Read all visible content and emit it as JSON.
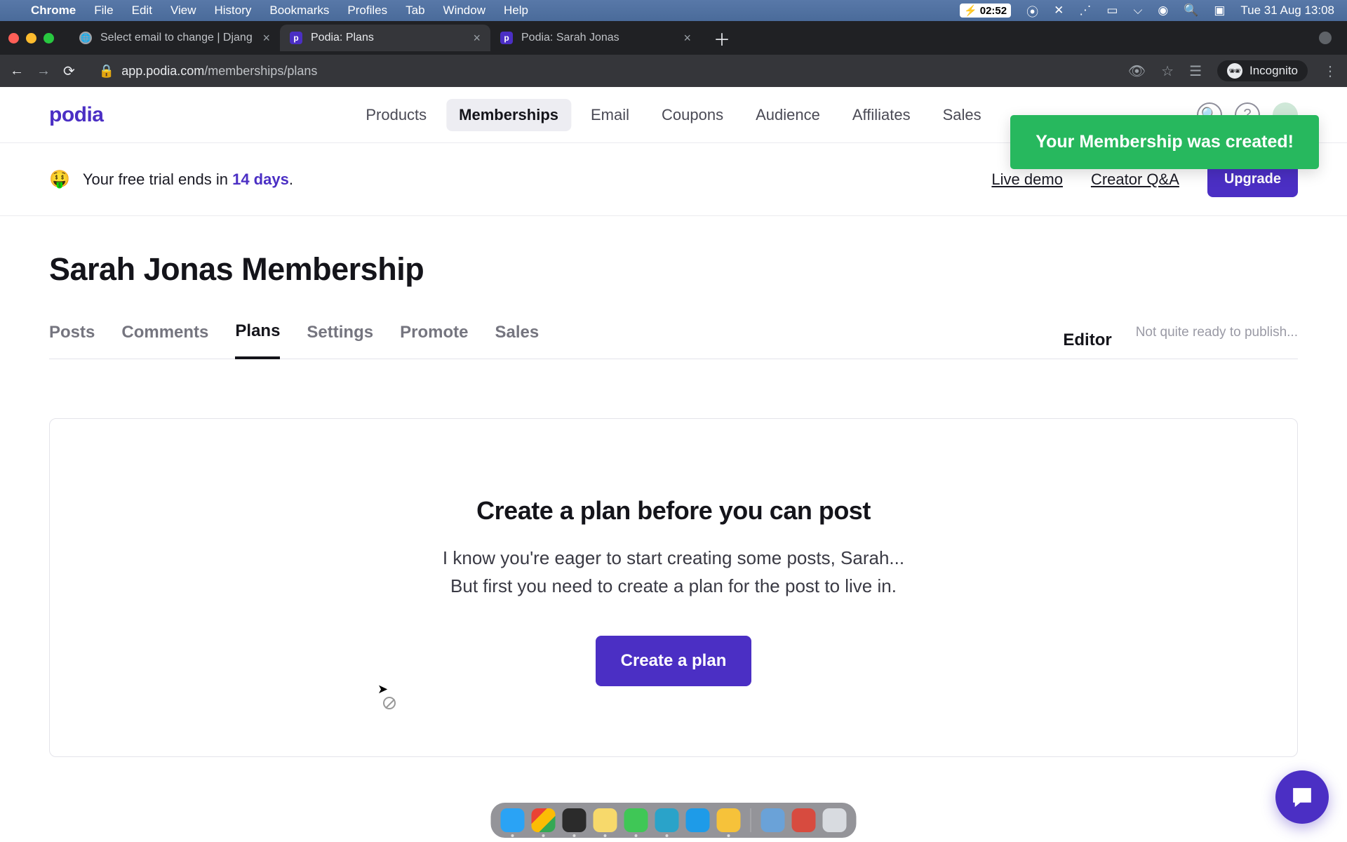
{
  "menubar": {
    "app": "Chrome",
    "items": [
      "File",
      "Edit",
      "View",
      "History",
      "Bookmarks",
      "Profiles",
      "Tab",
      "Window",
      "Help"
    ],
    "battery": "02:52",
    "datetime": "Tue 31 Aug  13:08"
  },
  "tabs": [
    {
      "title": "Select email to change | Djang",
      "favicon": "globe",
      "active": false
    },
    {
      "title": "Podia: Plans",
      "favicon": "p",
      "active": true
    },
    {
      "title": "Podia: Sarah Jonas",
      "favicon": "p",
      "active": false
    }
  ],
  "url": {
    "host": "app.podia.com",
    "path": "/memberships/plans",
    "incognito_label": "Incognito"
  },
  "header": {
    "logo": "podia",
    "nav": [
      "Products",
      "Memberships",
      "Email",
      "Coupons",
      "Audience",
      "Affiliates",
      "Sales"
    ],
    "active_nav": "Memberships"
  },
  "toast": {
    "message": "Your Membership was created!"
  },
  "trial": {
    "emoji": "🤑",
    "text_prefix": "Your free trial ends in ",
    "days": "14 days",
    "dot": ".",
    "live_demo": "Live demo",
    "creator_qa": "Creator Q&A",
    "upgrade": "Upgrade"
  },
  "page": {
    "title": "Sarah Jonas Membership"
  },
  "content_tabs": {
    "items": [
      "Posts",
      "Comments",
      "Plans",
      "Settings",
      "Promote",
      "Sales"
    ],
    "active": "Plans",
    "editor": "Editor",
    "publish_note": "Not quite ready to publish..."
  },
  "empty": {
    "heading": "Create a plan before you can post",
    "line1": "I know you're eager to start creating some posts, Sarah...",
    "line2": "But first you need to create a plan for the post to live in.",
    "cta": "Create a plan"
  },
  "dock": {
    "apps": [
      {
        "name": "finder",
        "color": "#2aa3f5"
      },
      {
        "name": "chrome",
        "color": "#ffffff"
      },
      {
        "name": "terminal",
        "color": "#2b2b2b"
      },
      {
        "name": "notes",
        "color": "#f7d96b"
      },
      {
        "name": "messages",
        "color": "#3fc756"
      },
      {
        "name": "xscope",
        "color": "#2aa3c9"
      },
      {
        "name": "safari",
        "color": "#1e9be8"
      },
      {
        "name": "pycharm",
        "color": "#f6c23a"
      },
      {
        "name": "folder",
        "color": "#6aa2d8"
      },
      {
        "name": "parallels",
        "color": "#d74b3f"
      },
      {
        "name": "trash",
        "color": "#d8dbe0"
      }
    ],
    "running": [
      "finder",
      "chrome",
      "terminal",
      "notes",
      "messages",
      "xscope",
      "pycharm"
    ]
  }
}
